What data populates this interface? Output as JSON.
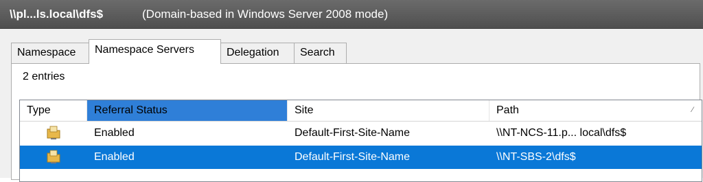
{
  "titlebar": {
    "path": "\\\\pl...ls.local\\dfs$",
    "mode": "(Domain-based in Windows Server 2008 mode)"
  },
  "tabs": [
    {
      "label": "Namespace",
      "active": false
    },
    {
      "label": "Namespace Servers",
      "active": true
    },
    {
      "label": "Delegation",
      "active": false
    },
    {
      "label": "Search",
      "active": false
    }
  ],
  "entries_label": "2 entries",
  "columns": {
    "type": "Type",
    "referral_status": "Referral Status",
    "site": "Site",
    "path": "Path"
  },
  "sort_indicator": "⁄",
  "rows": [
    {
      "icon": "folder-server-icon",
      "status": "Enabled",
      "site": "Default-First-Site-Name",
      "path": "\\\\NT-NCS-11.p... local\\dfs$",
      "selected": false
    },
    {
      "icon": "folder-server-icon",
      "status": "Enabled",
      "site": "Default-First-Site-Name",
      "path": "\\\\NT-SBS-2\\dfs$",
      "selected": true
    }
  ],
  "colors": {
    "selection": "#0a78d7",
    "sorted_header": "#2f7fd8",
    "titlebar": "#5a5a5a"
  }
}
